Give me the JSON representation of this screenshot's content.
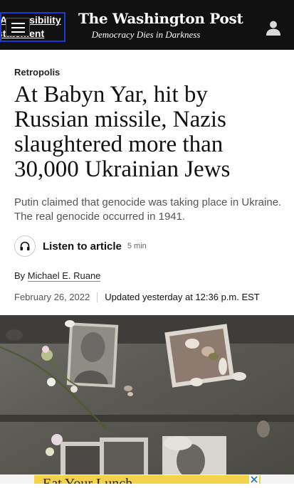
{
  "header": {
    "a11y_line1": "Accessibility",
    "a11y_line2": "statement",
    "logo": "The Washington Post",
    "tagline": "Democracy Dies in Darkness"
  },
  "article": {
    "section": "Retropolis",
    "headline": "At Babyn Yar, hit by Russian missile, Nazis slaughtered more than 30,000 Ukrainian Jews",
    "subheadline": "Putin claimed that genocide was taking place in Ukraine. The real genocide occurred in 1941.",
    "listen_label": "Listen to article",
    "listen_duration": "5 min",
    "byline_prefix": "By",
    "author": "Michael E. Ruane",
    "published": "February 26, 2022",
    "updated": "Updated yesterday at 12:36 p.m. EST"
  },
  "ad": {
    "text": "Eat Your Lunch"
  },
  "colors": {
    "header_bg": "#111111",
    "ad_bg": "#f3d34a",
    "focus_outline": "#1a3bd6"
  },
  "icons": {
    "menu": "hamburger-menu-icon",
    "account": "user-account-icon",
    "listen": "headphones-icon",
    "ad_close": "close-icon"
  }
}
